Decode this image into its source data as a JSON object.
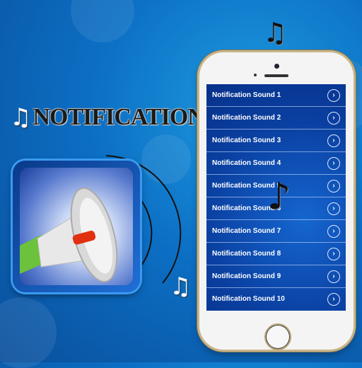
{
  "title": {
    "text": "NOTIFICATION",
    "note_icon": "music-note-icon"
  },
  "decor_notes": [
    "♫",
    "♫",
    "♫",
    "♪"
  ],
  "app_icon": {
    "name": "megaphone-icon"
  },
  "phone": {
    "list": [
      {
        "label": "Notification Sound 1"
      },
      {
        "label": "Notification Sound 2"
      },
      {
        "label": "Notification Sound 3"
      },
      {
        "label": "Notification Sound 4"
      },
      {
        "label": "Notification Sound 5"
      },
      {
        "label": "Notification Sound 6"
      },
      {
        "label": "Notification Sound 7"
      },
      {
        "label": "Notification Sound 8"
      },
      {
        "label": "Notification Sound 9"
      },
      {
        "label": "Notification Sound 10"
      }
    ],
    "chevron": "›"
  }
}
